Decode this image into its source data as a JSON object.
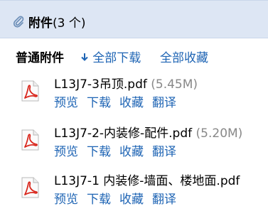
{
  "header": {
    "title_bold": "附件",
    "count_text": "(3 个)"
  },
  "toolbar": {
    "group_label": "普通附件",
    "download_all": "全部下载",
    "collect_all": "全部收藏"
  },
  "files": [
    {
      "name": "L13J7-3吊顶.pdf",
      "size": "(5.45M)",
      "actions": [
        "预览",
        "下载",
        "收藏",
        "翻译"
      ]
    },
    {
      "name": "L13J7-2-内装修-配件.pdf",
      "size": "(5.20M)",
      "actions": [
        "预览",
        "下载",
        "收藏",
        "翻译"
      ]
    },
    {
      "name": "L13J7-1 内装修-墙面、楼地面.pdf",
      "size": "",
      "actions": [
        "预览",
        "下载",
        "收藏",
        "翻译"
      ]
    }
  ],
  "icons": {
    "header": "paperclip-icon",
    "download": "arrow-down-icon",
    "file": "pdf-file-icon"
  },
  "colors": {
    "header_bg": "#dde6f4",
    "link": "#1e64b4",
    "size_text": "#888888",
    "pdf_red": "#d9261c"
  }
}
